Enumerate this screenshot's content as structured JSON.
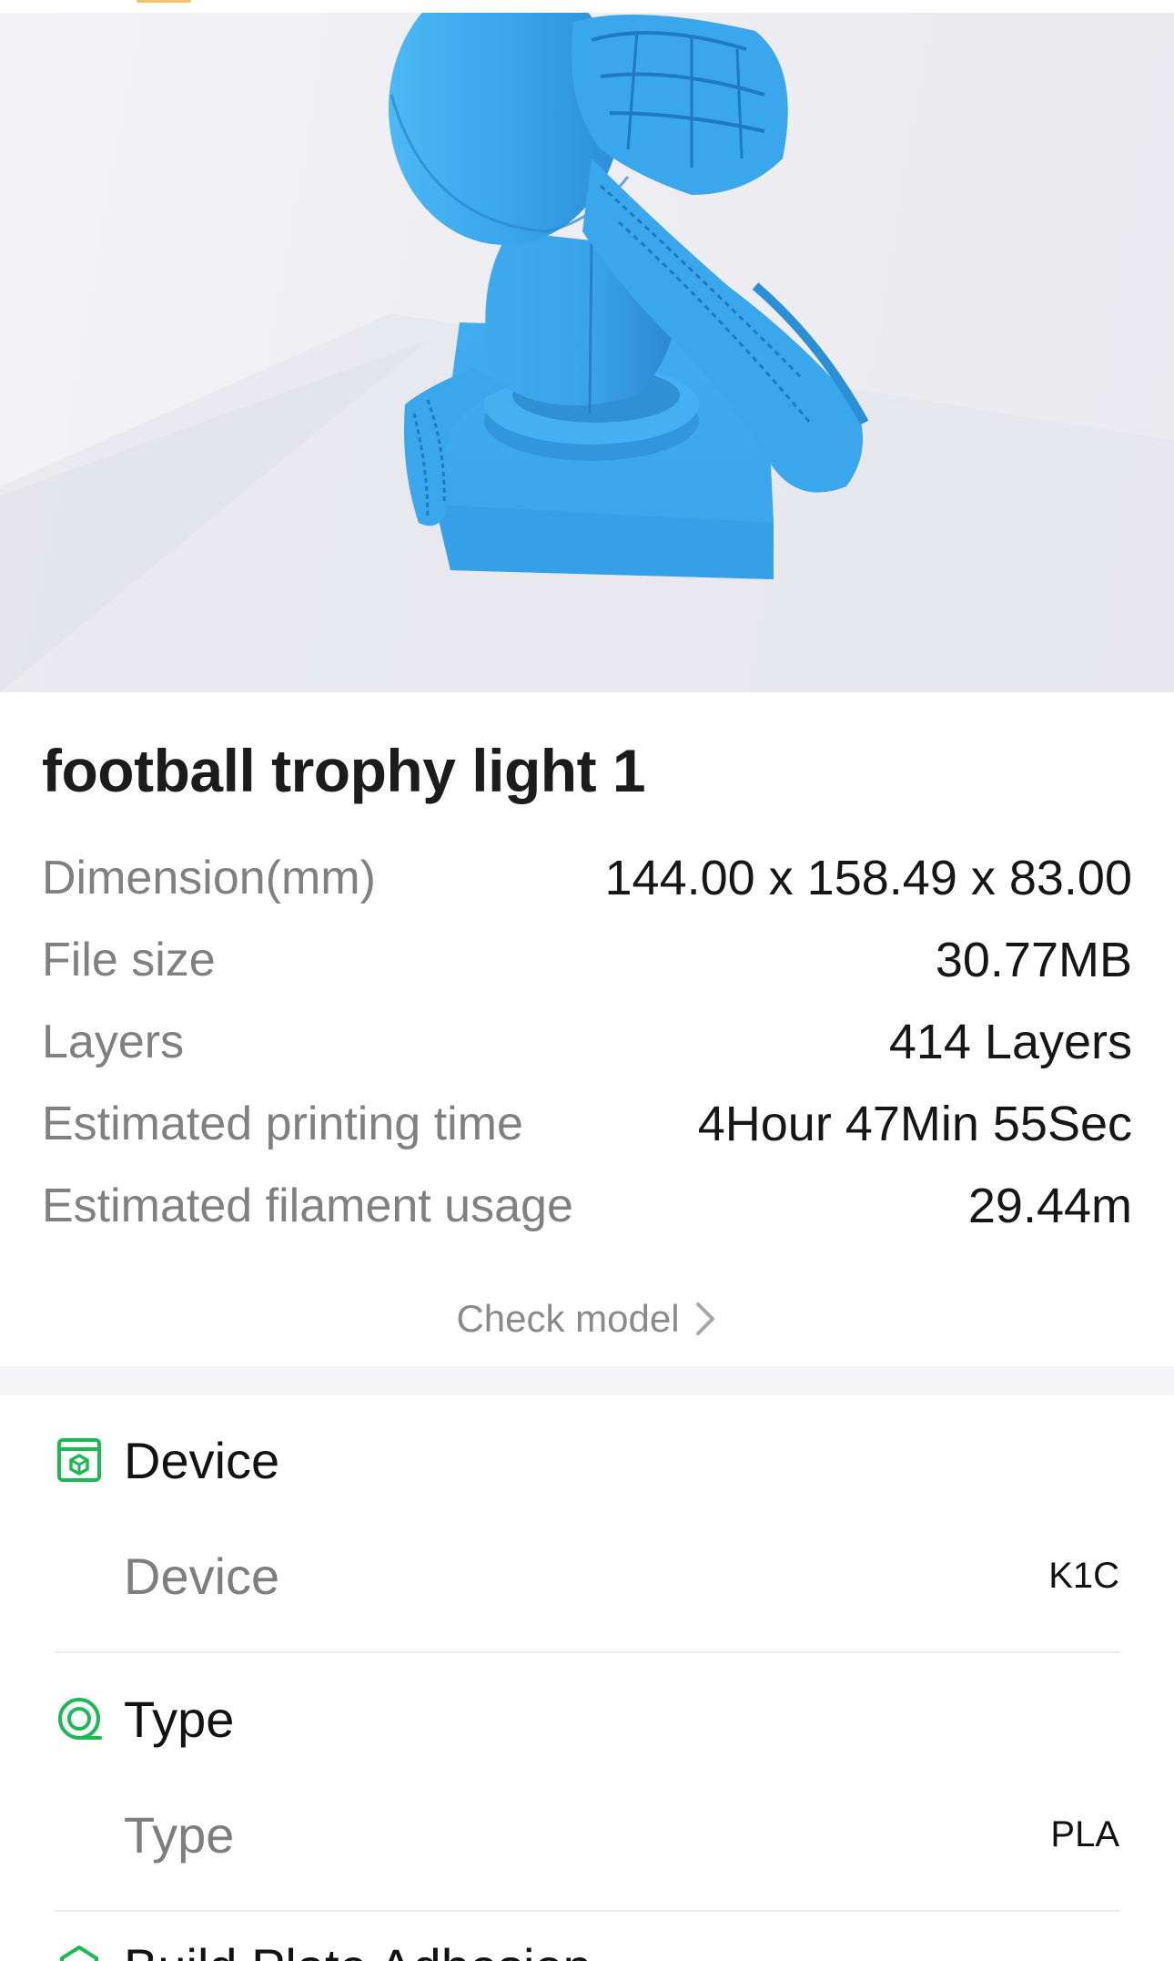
{
  "model": {
    "title": "football trophy light 1"
  },
  "specs": [
    {
      "label": "Dimension(mm)",
      "value": "144.00 x 158.49 x 83.00"
    },
    {
      "label": "File size",
      "value": "30.77MB"
    },
    {
      "label": "Layers",
      "value": "414 Layers"
    },
    {
      "label": "Estimated printing time",
      "value": "4Hour 47Min 55Sec"
    },
    {
      "label": "Estimated filament usage",
      "value": "29.44m"
    }
  ],
  "check_model": {
    "label": "Check model",
    "icon": "chevron-right-icon"
  },
  "sections": [
    {
      "title": "Device",
      "icon": "printer-icon",
      "row_label": "Device",
      "row_value": "K1C"
    },
    {
      "title": "Type",
      "icon": "filament-spool-icon",
      "row_label": "Type",
      "row_value": "PLA"
    },
    {
      "title": "Build Plate Adhesion",
      "icon": "build-plate-icon"
    }
  ],
  "colors": {
    "accent": "#1DB954",
    "model_blue": "#3AA6EC",
    "label_gray": "#808080"
  }
}
